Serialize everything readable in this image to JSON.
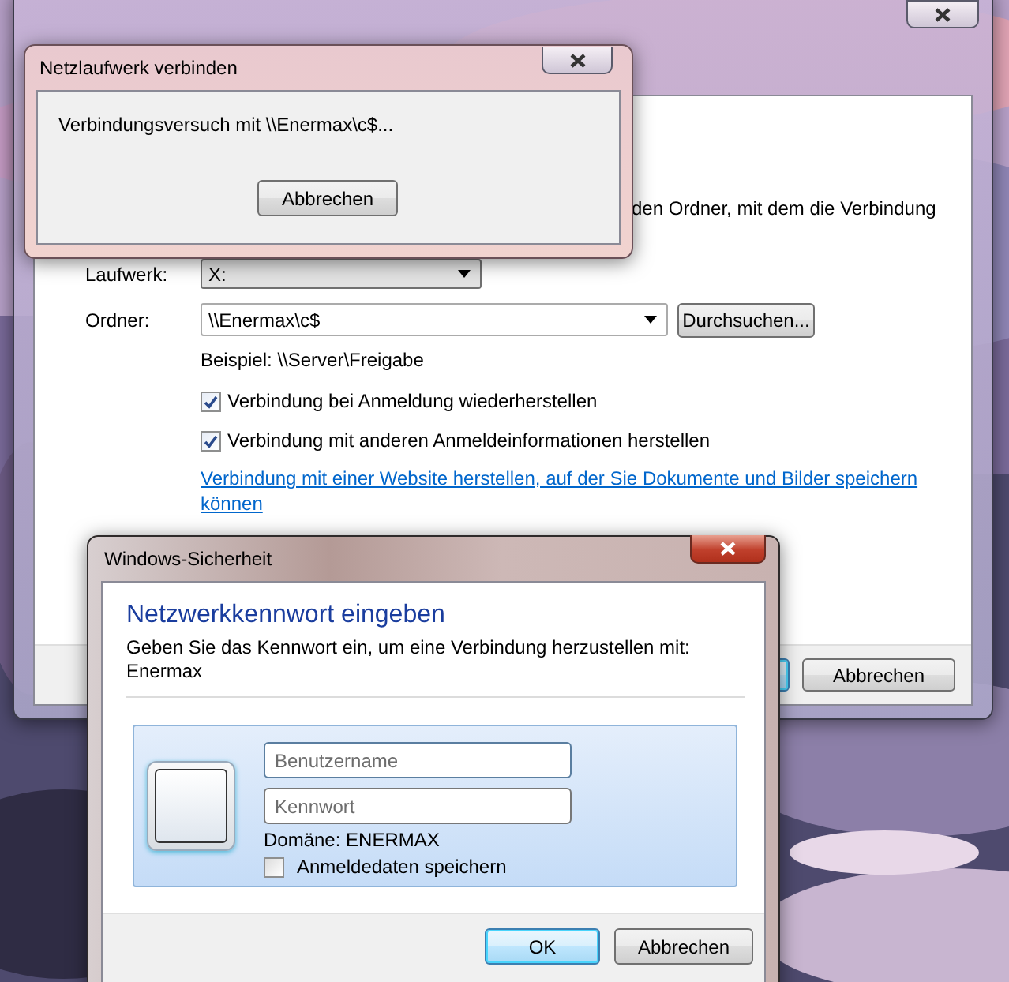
{
  "main_window": {
    "partial_text": "den Ordner, mit dem die Verbindung",
    "drive": {
      "label": "Laufwerk:",
      "value": "X:"
    },
    "folder": {
      "label": "Ordner:",
      "value": "\\\\Enermax\\c$"
    },
    "browse_button": "Durchsuchen...",
    "example": "Beispiel: \\\\Server\\Freigabe",
    "checkboxes": [
      {
        "label": "Verbindung bei Anmeldung wiederherstellen",
        "checked": true
      },
      {
        "label": "Verbindung mit anderen Anmeldeinformationen herstellen",
        "checked": true
      }
    ],
    "link": "Verbindung mit einer Website herstellen, auf der Sie Dokumente und Bilder speichern können",
    "cancel_button": "Abbrechen"
  },
  "progress_dialog": {
    "title": "Netzlaufwerk verbinden",
    "message": "Verbindungsversuch mit \\\\Enermax\\c$...",
    "cancel_button": "Abbrechen"
  },
  "security_dialog": {
    "title": "Windows-Sicherheit",
    "heading": "Netzwerkkennwort eingeben",
    "description": "Geben Sie das Kennwort ein, um eine Verbindung herzustellen mit: Enermax",
    "username": {
      "placeholder": "Benutzername"
    },
    "password": {
      "placeholder": "Kennwort"
    },
    "domain": "Domäne: ENERMAX",
    "remember": {
      "label": "Anmeldedaten speichern",
      "checked": false
    },
    "buttons": [
      {
        "label": "OK",
        "default": true
      },
      {
        "label": "Abbrechen",
        "default": false
      }
    ]
  }
}
